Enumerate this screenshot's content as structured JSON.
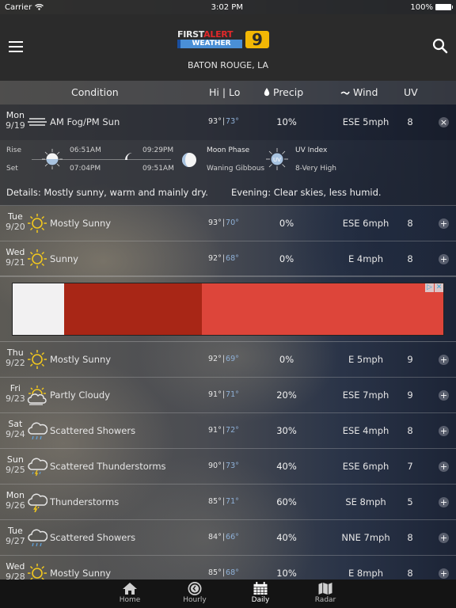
{
  "status_bar": {
    "carrier": "Carrier",
    "time": "3:02 PM",
    "battery": "100%"
  },
  "header": {
    "logo_first": "FIRST",
    "logo_alert": "ALERT",
    "logo_weather": "WEATHER",
    "logo_channel": "9",
    "location": "BATON ROUGE, LA",
    "menu_icon": "hamburger-menu-icon",
    "search_icon": "search-icon"
  },
  "columns": {
    "condition": "Condition",
    "hilo": "Hi | Lo",
    "precip": "Precip",
    "wind": "Wind",
    "uv": "UV"
  },
  "colors": {
    "lo_temp": "#8fb1d8",
    "sun_yellow": "#f2c81e",
    "header_bg": "#2b2b2b",
    "tabbar_bg": "#141414",
    "logo_red": "#e0282a",
    "logo_blue": "#4a8fd6",
    "logo_yellow": "#f2b705"
  },
  "days": [
    {
      "day": "Mon",
      "date": "9/19",
      "icon": "fog-icon",
      "condition": "AM Fog/PM Sun",
      "hi": "93°",
      "lo": "73°",
      "precip": "10%",
      "wind": "ESE 5mph",
      "uv": "8",
      "expanded": true
    },
    {
      "day": "Tue",
      "date": "9/20",
      "icon": "sun-icon",
      "condition": "Mostly Sunny",
      "hi": "93°",
      "lo": "70°",
      "precip": "0%",
      "wind": "ESE 6mph",
      "uv": "8",
      "expanded": false
    },
    {
      "day": "Wed",
      "date": "9/21",
      "icon": "sun-icon",
      "condition": "Sunny",
      "hi": "92°",
      "lo": "68°",
      "precip": "0%",
      "wind": "E 4mph",
      "uv": "8",
      "expanded": false
    },
    {
      "day": "Thu",
      "date": "9/22",
      "icon": "sun-icon",
      "condition": "Mostly Sunny",
      "hi": "92°",
      "lo": "69°",
      "precip": "0%",
      "wind": "E 5mph",
      "uv": "9",
      "expanded": false
    },
    {
      "day": "Fri",
      "date": "9/23",
      "icon": "partly-cloudy-icon",
      "condition": "Partly Cloudy",
      "hi": "91°",
      "lo": "71°",
      "precip": "20%",
      "wind": "ESE 7mph",
      "uv": "9",
      "expanded": false
    },
    {
      "day": "Sat",
      "date": "9/24",
      "icon": "showers-icon",
      "condition": "Scattered Showers",
      "hi": "91°",
      "lo": "72°",
      "precip": "30%",
      "wind": "ESE 4mph",
      "uv": "8",
      "expanded": false
    },
    {
      "day": "Sun",
      "date": "9/25",
      "icon": "scattered-thunderstorms-icon",
      "condition": "Scattered Thunderstorms",
      "hi": "90°",
      "lo": "73°",
      "precip": "40%",
      "wind": "ESE 6mph",
      "uv": "7",
      "expanded": false
    },
    {
      "day": "Mon",
      "date": "9/26",
      "icon": "thunderstorms-icon",
      "condition": "Thunderstorms",
      "hi": "85°",
      "lo": "71°",
      "precip": "60%",
      "wind": "SE 8mph",
      "uv": "5",
      "expanded": false
    },
    {
      "day": "Tue",
      "date": "9/27",
      "icon": "showers-icon",
      "condition": "Scattered Showers",
      "hi": "84°",
      "lo": "66°",
      "precip": "40%",
      "wind": "NNE 7mph",
      "uv": "8",
      "expanded": false
    },
    {
      "day": "Wed",
      "date": "9/28",
      "icon": "sun-icon",
      "condition": "Mostly Sunny",
      "hi": "85°",
      "lo": "68°",
      "precip": "10%",
      "wind": "E 8mph",
      "uv": "8",
      "expanded": false
    }
  ],
  "details": {
    "rise_label": "Rise",
    "set_label": "Set",
    "sunrise": "06:51AM",
    "sunset": "07:04PM",
    "moonrise": "09:29PM",
    "moonset": "09:51AM",
    "moon_phase_label": "Moon Phase",
    "moon_phase": "Waning Gibbous",
    "uv_badge": "UV",
    "uv_index_label": "UV Index",
    "uv_index": "8-Very High",
    "details_text": "Details: Mostly sunny, warm and mainly dry.",
    "evening_text": "Evening: Clear skies, less humid."
  },
  "ad": {
    "adchoices_icon": "adchoices-icon",
    "close_icon": "ad-close-icon"
  },
  "tabbar": {
    "tabs": [
      {
        "label": "Home",
        "icon": "home-icon",
        "active": false
      },
      {
        "label": "Hourly",
        "icon": "clock-icon",
        "active": false
      },
      {
        "label": "Daily",
        "icon": "calendar-icon",
        "active": true
      },
      {
        "label": "Radar",
        "icon": "map-icon",
        "active": false
      }
    ]
  }
}
